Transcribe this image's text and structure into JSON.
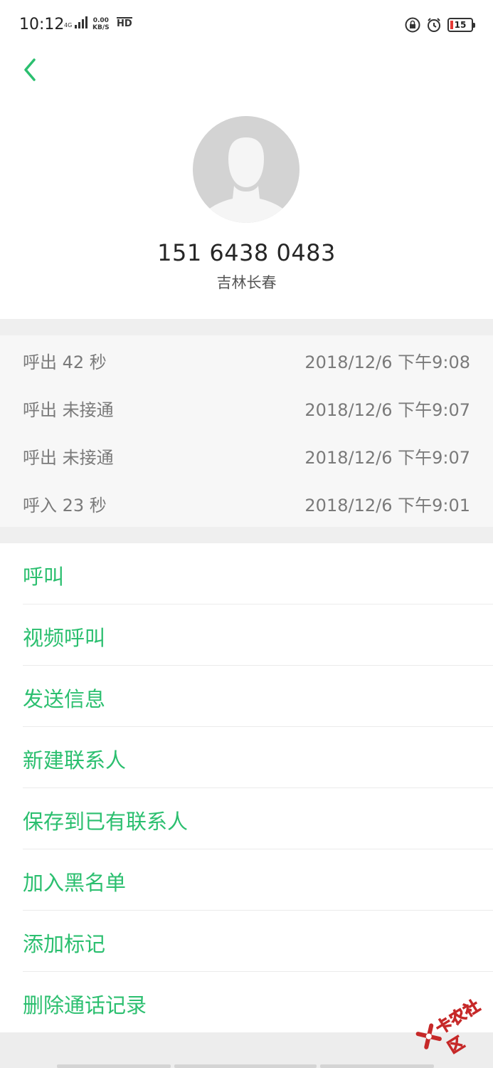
{
  "status_bar": {
    "time": "10:12",
    "net_label": "4G",
    "speed_value": "0.00",
    "speed_unit": "KB/S",
    "hd": "HD",
    "battery": "15",
    "icons": [
      "lock-icon",
      "alarm-icon",
      "battery-icon"
    ],
    "battery_low_color": "#e53935"
  },
  "header": {
    "back_icon": "chevron-left-icon",
    "phone_number": "151 6438 0483",
    "location": "吉林长春"
  },
  "call_log": [
    {
      "type": "呼出  42 秒",
      "time": "2018/12/6 下午9:08"
    },
    {
      "type": "呼出 未接通",
      "time": "2018/12/6 下午9:07"
    },
    {
      "type": "呼出 未接通",
      "time": "2018/12/6 下午9:07"
    },
    {
      "type": "呼入  23 秒",
      "time": "2018/12/6 下午9:01"
    }
  ],
  "actions": [
    {
      "label": "呼叫"
    },
    {
      "label": "视频呼叫"
    },
    {
      "label": "发送信息"
    },
    {
      "label": "新建联系人"
    },
    {
      "label": "保存到已有联系人"
    },
    {
      "label": "加入黑名单"
    },
    {
      "label": "添加标记"
    },
    {
      "label": "删除通话记录"
    }
  ],
  "watermark": {
    "text": "卡农社区"
  },
  "colors": {
    "accent": "#2bbf6f",
    "secondary_text": "#7a7a7a",
    "divider_band": "#efefef"
  }
}
